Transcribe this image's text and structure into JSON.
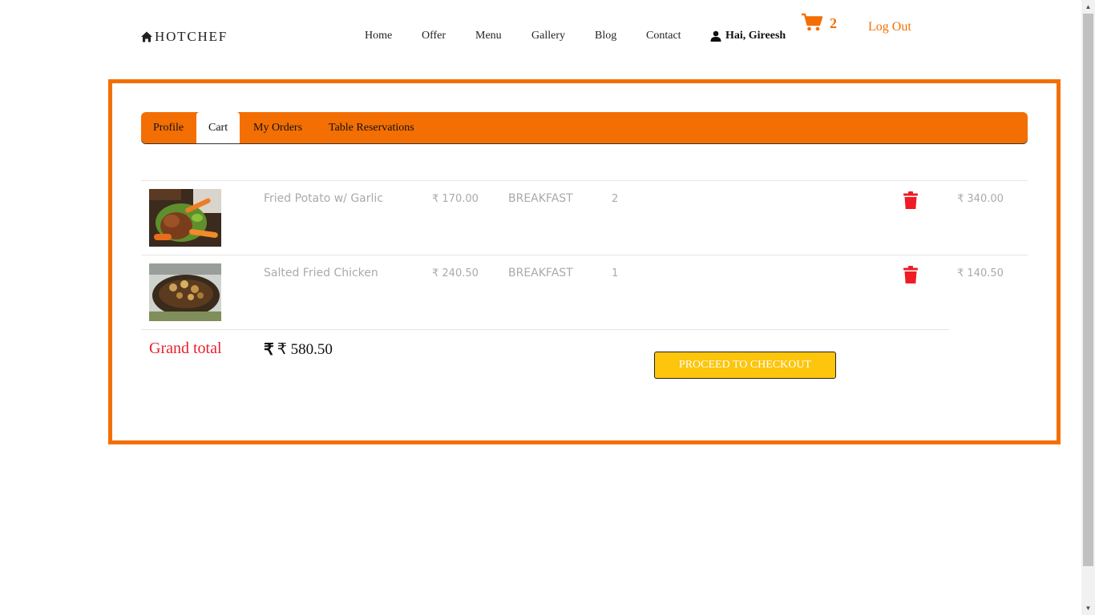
{
  "brand": {
    "name": "HOTCHEF",
    "icon": "home-icon"
  },
  "nav": {
    "items": [
      "Home",
      "Offer",
      "Menu",
      "Gallery",
      "Blog",
      "Contact"
    ],
    "user_greeting": "Hai, Gireesh",
    "user_icon": "user-icon",
    "cart_icon": "cart-icon",
    "cart_count": "2",
    "logout_label": "Log Out"
  },
  "tabs": [
    {
      "label": "Profile",
      "active": false
    },
    {
      "label": "Cart",
      "active": true
    },
    {
      "label": "My Orders",
      "active": false
    },
    {
      "label": "Table Reservations",
      "active": false
    }
  ],
  "cart": {
    "items": [
      {
        "name": "Fried Potato w/ Garlic",
        "price": "₹ 170.00",
        "category": "BREAKFAST",
        "qty": "2",
        "total": "₹ 340.00",
        "image": "fried-potato-photo"
      },
      {
        "name": "Salted Fried Chicken",
        "price": "₹ 240.50",
        "category": "BREAKFAST",
        "qty": "1",
        "total": "₹ 140.50",
        "image": "fried-chicken-photo"
      }
    ],
    "grand_total_label": "Grand total",
    "grand_total_value": "₹ 580.50",
    "checkout_label": "PROCEED TO CHECKOUT"
  },
  "colors": {
    "accent": "#f36f03",
    "danger": "#e8222a",
    "button": "#fdc50b"
  }
}
